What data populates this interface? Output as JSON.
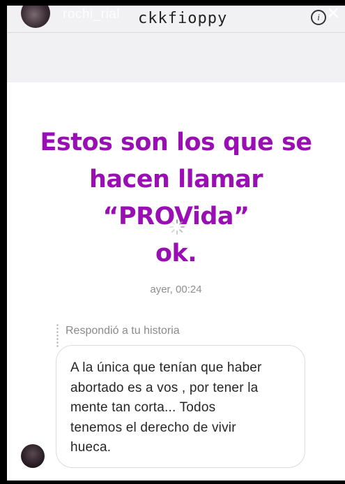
{
  "header": {
    "ghost_username": "rochi_rial",
    "username": "ckkfioppy",
    "info_glyph": "i",
    "close_glyph": "✕"
  },
  "story": {
    "line1": "Estos son los que se",
    "line2": "hacen llamar “PROVida”",
    "line3": "ok.",
    "text_color": "#9a0fb4"
  },
  "message": {
    "timestamp": "ayer, 00:24",
    "reply_label": "Respondió a tu historia",
    "body_lines": [
      "A la única que tenían que haber",
      "abortado es a vos , por tener la",
      "mente tan corta... Todos",
      "tenemos el derecho de vivir",
      "hueca."
    ]
  },
  "icons": {
    "info": "info-icon",
    "close": "close-icon",
    "loading": "loading-spinner-icon"
  }
}
